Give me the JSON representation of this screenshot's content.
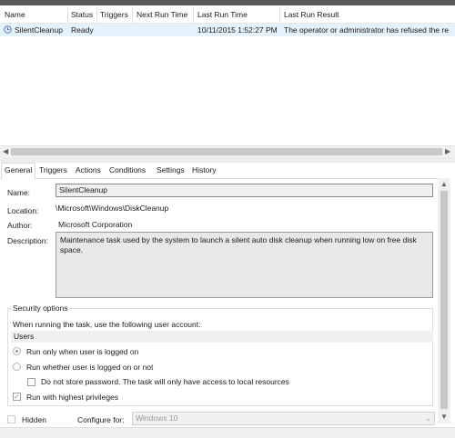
{
  "task_list": {
    "columns": [
      "Name",
      "Status",
      "Triggers",
      "Next Run Time",
      "Last Run Time",
      "Last Run Result"
    ],
    "rows": [
      {
        "name": "SilentCleanup",
        "status": "Ready",
        "triggers": "",
        "next_run_time": "",
        "last_run_time": "10/11/2015 1:52:27 PM",
        "last_run_result": "The operator or administrator has refused the re"
      }
    ]
  },
  "tabs": [
    "General",
    "Triggers",
    "Actions",
    "Conditions",
    "Settings",
    "History"
  ],
  "active_tab": "General",
  "general": {
    "name_label": "Name:",
    "name_value": "SilentCleanup",
    "location_label": "Location:",
    "location_value": "\\Microsoft\\Windows\\DiskCleanup",
    "author_label": "Author:",
    "author_value": "Microsoft Corporation",
    "description_label": "Description:",
    "description_value": "Maintenance task used by the system to launch a silent auto disk cleanup when running low on free disk space."
  },
  "security": {
    "title": "Security options",
    "account_prompt": "When running the task, use the following user account:",
    "account_value": "Users",
    "run_only_logged_on": "Run only when user is logged on",
    "run_whether_logged_on": "Run whether user is logged on or not",
    "do_not_store_password": "Do not store password.  The task will only have access to local resources",
    "run_highest_privileges": "Run with highest privileges",
    "selected_option": "Run only when user is logged on",
    "highest_privileges_checked": true
  },
  "footer": {
    "hidden_label": "Hidden",
    "configure_for_label": "Configure for:",
    "configure_for_value": "Windows 10"
  }
}
